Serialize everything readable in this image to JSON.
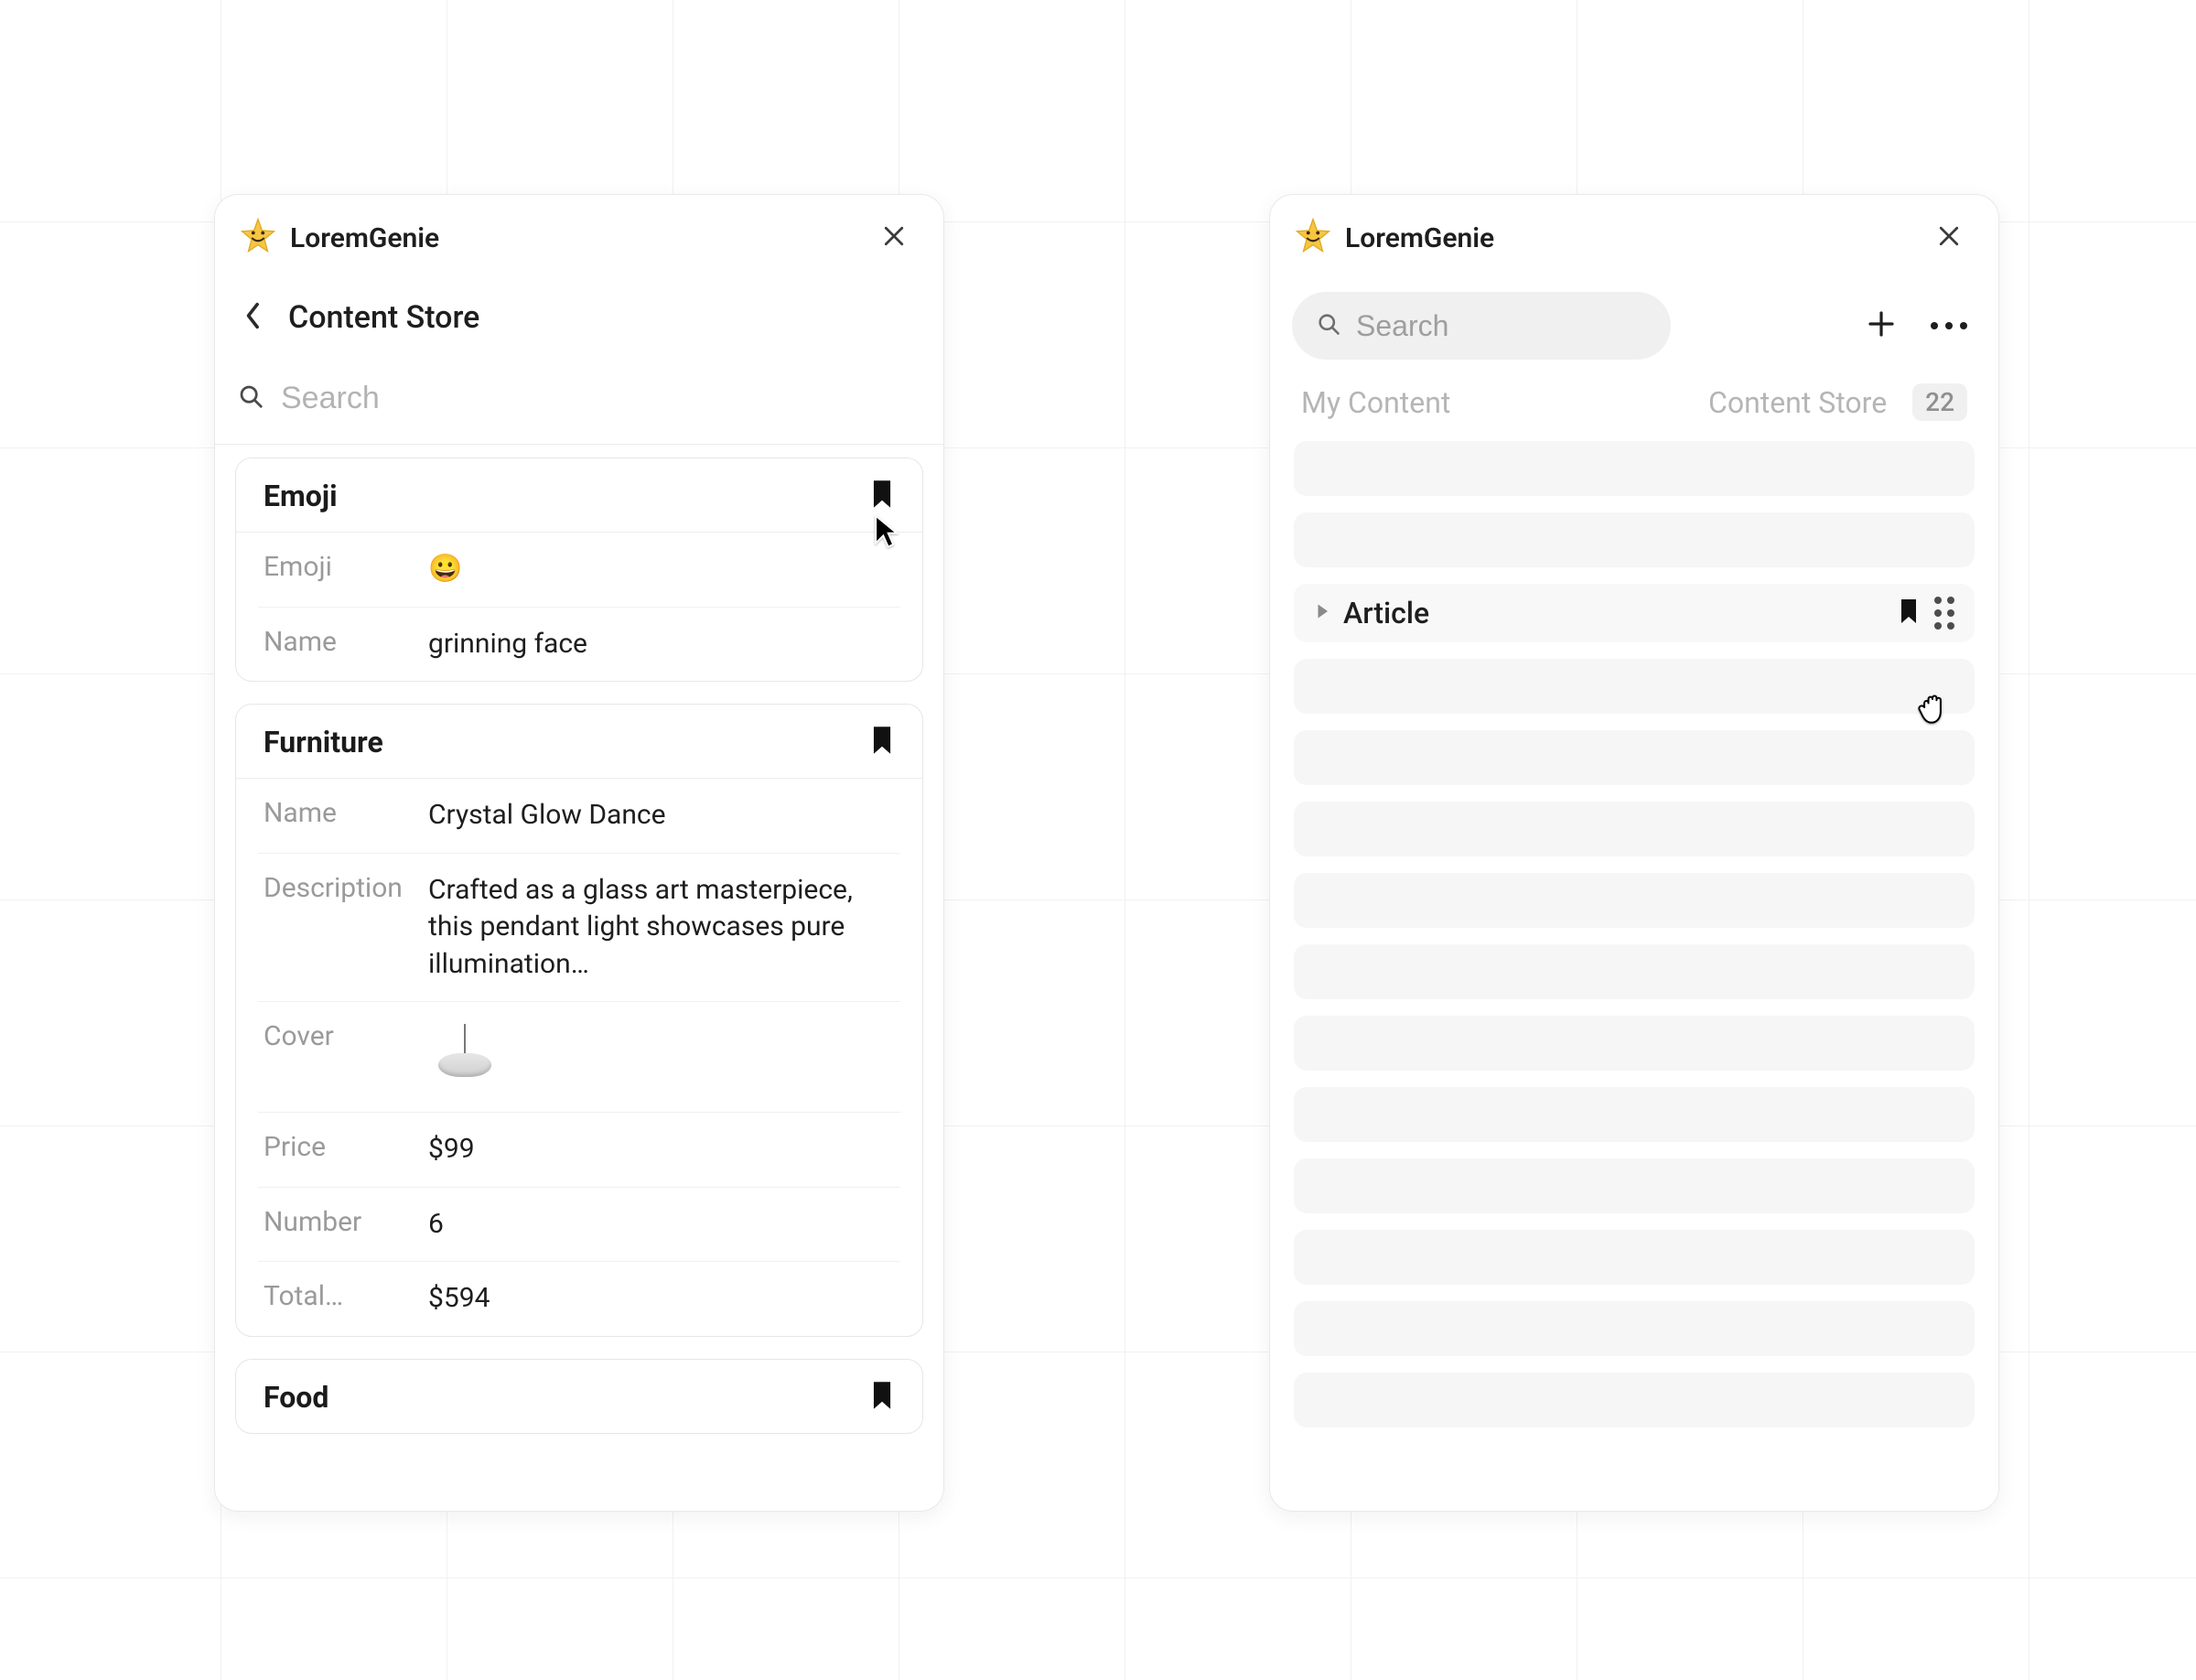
{
  "product": "LoremGenie",
  "left_panel": {
    "breadcrumb": "Content Store",
    "search_placeholder": "Search",
    "cards": {
      "emoji": {
        "title": "Emoji",
        "emoji_label": "Emoji",
        "emoji_value": "😀",
        "name_label": "Name",
        "name_value": "grinning face"
      },
      "furniture": {
        "title": "Furniture",
        "name_label": "Name",
        "name_value": "Crystal Glow Dance",
        "description_label": "Description",
        "description_value": "Crafted as a glass art masterpiece, this pendant light showcases pure illumination…",
        "cover_label": "Cover",
        "price_label": "Price",
        "price_value": "$99",
        "number_label": "Number",
        "number_value": "6",
        "total_label": "Total…",
        "total_value": "$594"
      },
      "food": {
        "title": "Food"
      }
    }
  },
  "right_panel": {
    "search_placeholder": "Search",
    "tabs": {
      "my_content": "My Content",
      "content_store": "Content Store",
      "badge": "22"
    },
    "item": {
      "article_label": "Article"
    }
  }
}
